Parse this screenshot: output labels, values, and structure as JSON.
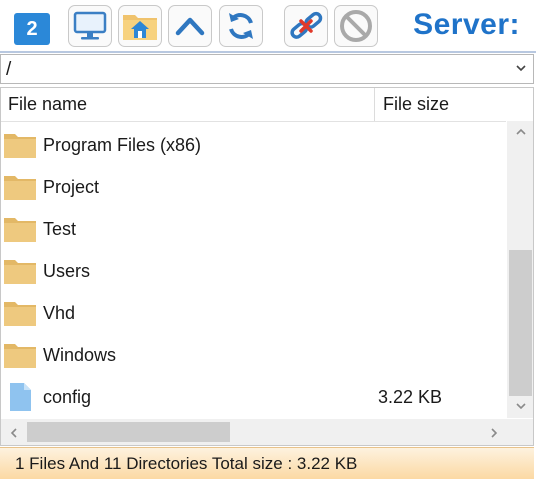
{
  "toolbar": {
    "badge": "2",
    "buttons": [
      {
        "icon": "computer-icon"
      },
      {
        "icon": "folder-home-icon"
      },
      {
        "icon": "up-arrow-icon"
      },
      {
        "icon": "refresh-icon"
      },
      {
        "icon": "disconnect-icon"
      },
      {
        "icon": "stop-icon"
      }
    ],
    "server_label": "Server:"
  },
  "path_bar": {
    "value": "/"
  },
  "file_list": {
    "columns": {
      "name": "File name",
      "size": "File size"
    },
    "rows": [
      {
        "name": "Program Files (x86)",
        "size": "",
        "type": "folder"
      },
      {
        "name": "Project",
        "size": "",
        "type": "folder"
      },
      {
        "name": "Test",
        "size": "",
        "type": "folder"
      },
      {
        "name": "Users",
        "size": "",
        "type": "folder"
      },
      {
        "name": "Vhd",
        "size": "",
        "type": "folder"
      },
      {
        "name": "Windows",
        "size": "",
        "type": "folder"
      },
      {
        "name": "config",
        "size": "3.22 KB",
        "type": "file"
      }
    ]
  },
  "status": {
    "text": "1 Files And 11 Directories Total size : 3.22 KB"
  },
  "colors": {
    "accent": "#1f73c9",
    "folder": "#e8c580",
    "file": "#8fc3ef",
    "status_bg": "#fcd9a3"
  }
}
